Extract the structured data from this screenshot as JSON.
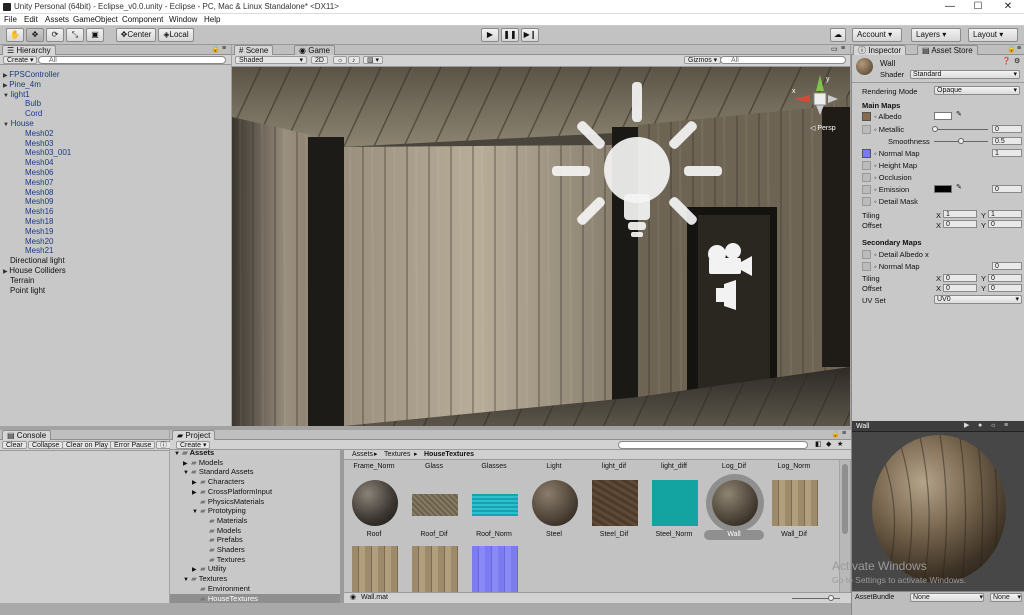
{
  "window": {
    "title": "Unity Personal (64bit) - Eclipse_v0.0.unity - Eclipse - PC, Mac & Linux Standalone* <DX11>",
    "minimize": "—",
    "maximize": "☐",
    "close": "✕"
  },
  "menu": [
    "File",
    "Edit",
    "Assets",
    "GameObject",
    "Component",
    "Window",
    "Help"
  ],
  "toolbar": {
    "pivot": "Center",
    "space": "Local",
    "account": "Account",
    "layers": "Layers",
    "layout": "Layout"
  },
  "hierarchy": {
    "tab": "Hierarchy",
    "create": "Create",
    "search_placeholder": "All",
    "items": [
      {
        "label": "FPSController",
        "indent": 0,
        "arrow": "▶",
        "color": "blue"
      },
      {
        "label": "Pine_4m",
        "indent": 0,
        "arrow": "▶",
        "color": "blue"
      },
      {
        "label": "light1",
        "indent": 0,
        "arrow": "▼",
        "color": "blue"
      },
      {
        "label": "Bulb",
        "indent": 1,
        "arrow": "",
        "color": "blue"
      },
      {
        "label": "Cord",
        "indent": 1,
        "arrow": "",
        "color": "blue"
      },
      {
        "label": "House",
        "indent": 0,
        "arrow": "▼",
        "color": "blue"
      },
      {
        "label": "Mesh02",
        "indent": 1,
        "arrow": "",
        "color": "blue"
      },
      {
        "label": "Mesh03",
        "indent": 1,
        "arrow": "",
        "color": "blue"
      },
      {
        "label": "Mesh03_001",
        "indent": 1,
        "arrow": "",
        "color": "blue"
      },
      {
        "label": "Mesh04",
        "indent": 1,
        "arrow": "",
        "color": "blue"
      },
      {
        "label": "Mesh06",
        "indent": 1,
        "arrow": "",
        "color": "blue"
      },
      {
        "label": "Mesh07",
        "indent": 1,
        "arrow": "",
        "color": "blue"
      },
      {
        "label": "Mesh08",
        "indent": 1,
        "arrow": "",
        "color": "blue"
      },
      {
        "label": "Mesh09",
        "indent": 1,
        "arrow": "",
        "color": "blue"
      },
      {
        "label": "Mesh16",
        "indent": 1,
        "arrow": "",
        "color": "blue"
      },
      {
        "label": "Mesh18",
        "indent": 1,
        "arrow": "",
        "color": "blue"
      },
      {
        "label": "Mesh19",
        "indent": 1,
        "arrow": "",
        "color": "blue"
      },
      {
        "label": "Mesh20",
        "indent": 1,
        "arrow": "",
        "color": "blue"
      },
      {
        "label": "Mesh21",
        "indent": 1,
        "arrow": "",
        "color": "blue"
      },
      {
        "label": "Directional light",
        "indent": 0,
        "arrow": "",
        "color": "black"
      },
      {
        "label": "House Colliders",
        "indent": 0,
        "arrow": "▶",
        "color": "black"
      },
      {
        "label": "Terrain",
        "indent": 0,
        "arrow": "",
        "color": "black"
      },
      {
        "label": "Point light",
        "indent": 0,
        "arrow": "",
        "color": "black"
      }
    ]
  },
  "scene": {
    "tab_scene": "Scene",
    "tab_game": "Game",
    "shading": "Shaded",
    "mode2d": "2D",
    "gizmos": "Gizmos",
    "search_placeholder": "All",
    "persp": "◁ Persp"
  },
  "inspector": {
    "tab": "Inspector",
    "tab2": "Asset Store",
    "object_name": "Wall",
    "shader_label": "Shader",
    "shader_value": "Standard",
    "rendering_mode_label": "Rendering Mode",
    "rendering_mode_value": "Opaque",
    "main_maps": "Main Maps",
    "albedo": "Albedo",
    "metallic": "Metallic",
    "metallic_value": "0",
    "smoothness": "Smoothness",
    "smoothness_value": "0.5",
    "normal_map": "Normal Map",
    "normal_value": "1",
    "height_map": "Height Map",
    "occlusion": "Occlusion",
    "emission": "Emission",
    "emission_value": "0",
    "detail_mask": "Detail Mask",
    "tiling": "Tiling",
    "offset": "Offset",
    "x": "X",
    "y": "Y",
    "tiling_x": "1",
    "tiling_y": "1",
    "offset_x": "0",
    "offset_y": "0",
    "secondary_maps": "Secondary Maps",
    "detail_albedo": "Detail Albedo x",
    "normal_map2": "Normal Map",
    "normal2_value": "0",
    "tiling2_x": "0",
    "tiling2_y": "0",
    "offset2_x": "0",
    "offset2_y": "0",
    "uv_set": "UV Set",
    "uv_set_value": "UV0"
  },
  "console": {
    "tab": "Console",
    "clear": "Clear",
    "collapse": "Collapse",
    "clear_on_play": "Clear on Play",
    "error_pause": "Error Pause"
  },
  "project": {
    "tab": "Project",
    "create": "Create",
    "tree": [
      {
        "label": "Assets",
        "indent": 0,
        "arrow": "▼",
        "bold": true
      },
      {
        "label": "Models",
        "indent": 1,
        "arrow": "▶",
        "bold": false
      },
      {
        "label": "Standard Assets",
        "indent": 1,
        "arrow": "▼",
        "bold": false
      },
      {
        "label": "Characters",
        "indent": 2,
        "arrow": "▶",
        "bold": false
      },
      {
        "label": "CrossPlatformInput",
        "indent": 2,
        "arrow": "▶",
        "bold": false
      },
      {
        "label": "PhysicsMaterials",
        "indent": 2,
        "arrow": "",
        "bold": false
      },
      {
        "label": "Prototyping",
        "indent": 2,
        "arrow": "▼",
        "bold": false
      },
      {
        "label": "Materials",
        "indent": 3,
        "arrow": "",
        "bold": false
      },
      {
        "label": "Models",
        "indent": 3,
        "arrow": "",
        "bold": false
      },
      {
        "label": "Prefabs",
        "indent": 3,
        "arrow": "",
        "bold": false
      },
      {
        "label": "Shaders",
        "indent": 3,
        "arrow": "",
        "bold": false
      },
      {
        "label": "Textures",
        "indent": 3,
        "arrow": "",
        "bold": false
      },
      {
        "label": "Utility",
        "indent": 2,
        "arrow": "▶",
        "bold": false
      },
      {
        "label": "Textures",
        "indent": 1,
        "arrow": "▼",
        "bold": false
      },
      {
        "label": "Environment",
        "indent": 2,
        "arrow": "",
        "bold": false
      },
      {
        "label": "HouseTextures",
        "indent": 2,
        "arrow": "",
        "bold": false,
        "selected": true
      }
    ],
    "breadcrumb": [
      "Assets",
      "Textures",
      "HouseTextures"
    ],
    "top_labels": [
      "Frame_Norm",
      "Glass",
      "Glasses",
      "Light",
      "light_dif",
      "light_diff",
      "Log_Dif",
      "Log_Norm"
    ],
    "assets_row1": [
      {
        "label": "Roof",
        "kind": "sphere-dark"
      },
      {
        "label": "Roof_Dif",
        "kind": "tex-gravel"
      },
      {
        "label": "Roof_Norm",
        "kind": "tex-teal"
      },
      {
        "label": "Steel",
        "kind": "sphere-steel"
      },
      {
        "label": "Steel_Dif",
        "kind": "tex-rust"
      },
      {
        "label": "Steel_Norm",
        "kind": "tex-cyan"
      },
      {
        "label": "Wall",
        "kind": "sphere-wood",
        "selected": true
      },
      {
        "label": "Wall_Dif",
        "kind": "tex-wood"
      }
    ],
    "assets_row2": [
      {
        "label": "",
        "kind": "tex-wood"
      },
      {
        "label": "",
        "kind": "tex-wood"
      },
      {
        "label": "",
        "kind": "tex-normal"
      }
    ],
    "footer_file": "Wall.mat"
  },
  "preview": {
    "title": "Wall",
    "watermark1": "Activate Windows",
    "watermark2": "Go to Settings to activate Windows.",
    "assetbundle": "AssetBundle",
    "none1": "None",
    "none2": "None"
  }
}
